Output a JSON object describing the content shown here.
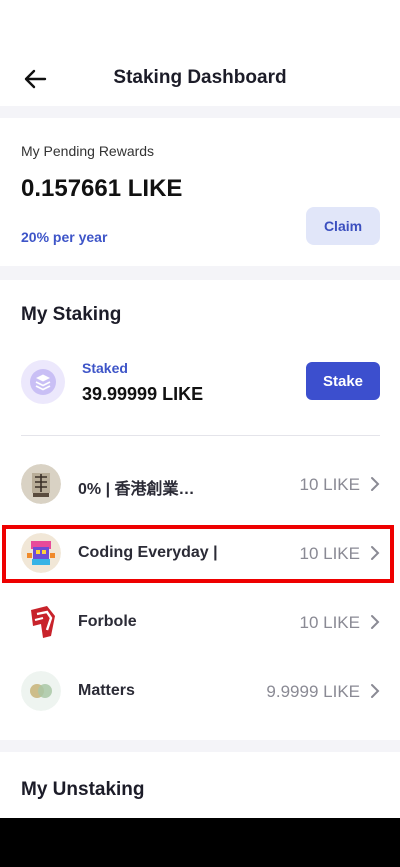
{
  "header": {
    "title": "Staking Dashboard",
    "back_icon": "arrow-left-icon"
  },
  "rewards": {
    "label": "My Pending Rewards",
    "amount": "0.157661 LIKE",
    "rate": "20% per year",
    "claim_label": "Claim"
  },
  "staking": {
    "title": "My Staking",
    "staked_label": "Staked",
    "staked_value": "39.99999 LIKE",
    "stake_label": "Stake",
    "validators": [
      {
        "name": "0% | 香港創業…",
        "value": "10 LIKE",
        "icon": "seal-avatar"
      },
      {
        "name": "Coding Everyday | …",
        "value": "10 LIKE",
        "icon": "pixel-avatar"
      },
      {
        "name": "Forbole",
        "value": "10 LIKE",
        "icon": "forbole-logo"
      },
      {
        "name": "Matters",
        "value": "9.9999 LIKE",
        "icon": "matters-logo"
      }
    ]
  },
  "unstaking": {
    "title": "My Unstaking"
  },
  "colors": {
    "accent": "#3c4fce",
    "highlight": "#ee0000"
  }
}
